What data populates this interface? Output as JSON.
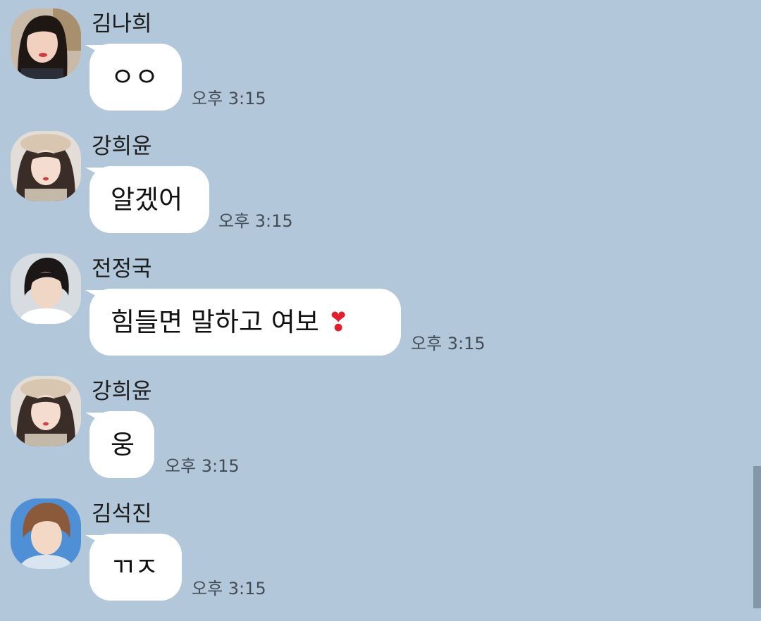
{
  "messages": [
    {
      "sender": "김나희",
      "text": "ㅇㅇ",
      "time": "오후 3:15"
    },
    {
      "sender": "강희윤",
      "text": "알겠어",
      "time": "오후 3:15"
    },
    {
      "sender": "전정국",
      "text": "힘들면 말하고 여보",
      "emoji": "❣",
      "time": "오후 3:15"
    },
    {
      "sender": "강희윤",
      "text": "웅",
      "time": "오후 3:15"
    },
    {
      "sender": "김석진",
      "text": "ㄲㅈ",
      "time": "오후 3:15"
    }
  ],
  "colors": {
    "background": "#b2c7d9",
    "bubble": "#ffffff",
    "time_text": "#454c56"
  }
}
